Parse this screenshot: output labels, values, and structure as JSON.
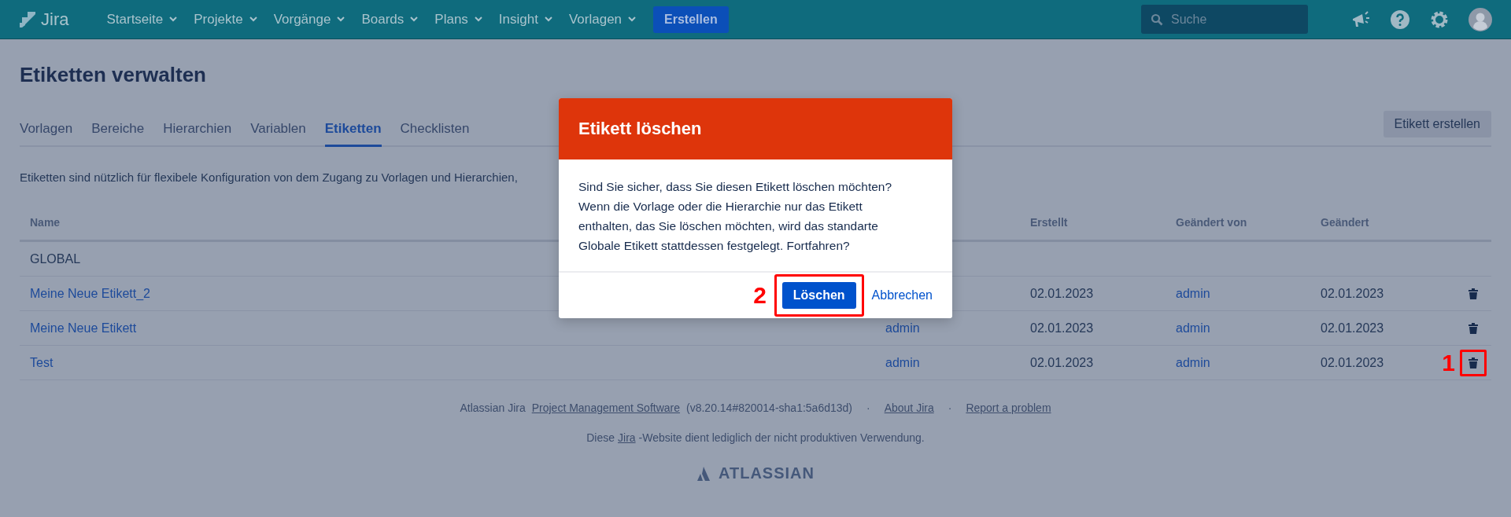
{
  "topbar": {
    "logo": "Jira",
    "nav": [
      {
        "label": "Startseite"
      },
      {
        "label": "Projekte"
      },
      {
        "label": "Vorgänge"
      },
      {
        "label": "Boards"
      },
      {
        "label": "Plans"
      },
      {
        "label": "Insight"
      },
      {
        "label": "Vorlagen"
      }
    ],
    "create_button": "Erstellen",
    "search": {
      "placeholder": "Suche"
    }
  },
  "page_title": "Etiketten verwalten",
  "tabs": [
    {
      "label": "Vorlagen",
      "selected": false
    },
    {
      "label": "Bereiche",
      "selected": false
    },
    {
      "label": "Hierarchien",
      "selected": false
    },
    {
      "label": "Variablen",
      "selected": false
    },
    {
      "label": "Etiketten",
      "selected": true
    },
    {
      "label": "Checklisten",
      "selected": false
    }
  ],
  "create_label_button": "Etikett erstellen",
  "description": "Etiketten sind nützlich für flexibele Konfiguration von dem Zugang zu Vorlagen und Hierarchien,",
  "table": {
    "columns": [
      "Name",
      "",
      "Erstellt",
      "Geändert von",
      "Geändert"
    ],
    "rows": [
      {
        "name": "GLOBAL",
        "link": false
      },
      {
        "name": "Meine Neue Etikett_2",
        "link": true,
        "created": "02.01.2023",
        "modified_by": "admin",
        "modified": "02.01.2023",
        "highlighted": false
      },
      {
        "name": "Meine Neue Etikett",
        "link": true,
        "column_2": "admin",
        "created": "02.01.2023",
        "modified_by": "admin",
        "modified": "02.01.2023",
        "highlighted": false
      },
      {
        "name": "Test",
        "link": true,
        "column_2": "admin",
        "created": "02.01.2023",
        "modified_by": "admin",
        "modified": "02.01.2023",
        "highlighted": true,
        "marker": "1"
      }
    ]
  },
  "footer": {
    "line_1": [
      {
        "text": "Atlassian Jira",
        "link": false
      },
      {
        "text": "Project Management Software",
        "link": true
      },
      {
        "text": "(v8.20.14#820014-sha1:5a6d13d)",
        "link": false
      },
      {
        "text": "·",
        "link": false
      },
      {
        "text": "About Jira",
        "link": true
      },
      {
        "text": "·",
        "link": false
      },
      {
        "text": "Report a problem",
        "link": true
      }
    ],
    "line_2": [
      {
        "text": "Diese",
        "link": false
      },
      {
        "text": "Jira",
        "link": true
      },
      {
        "text": "-Website dient lediglich der nicht produktiven Verwendung.",
        "link": false
      }
    ],
    "brand": "ATLASSIAN"
  },
  "dialog": {
    "title": "Etikett löschen",
    "message": "Sind Sie sicher, dass Sie diesen Etikett löschen möchten? Wenn die Vorlage oder die Hierarchie nur das Etikett enthalten, das Sie löschen möchten, wird das standarte Globale Etikett stattdessen festgelegt. Fortfahren?",
    "confirm_button": "Löschen",
    "confirm_highlighted": true,
    "confirm_marker": "2",
    "cancel_link": "Abbrechen"
  }
}
